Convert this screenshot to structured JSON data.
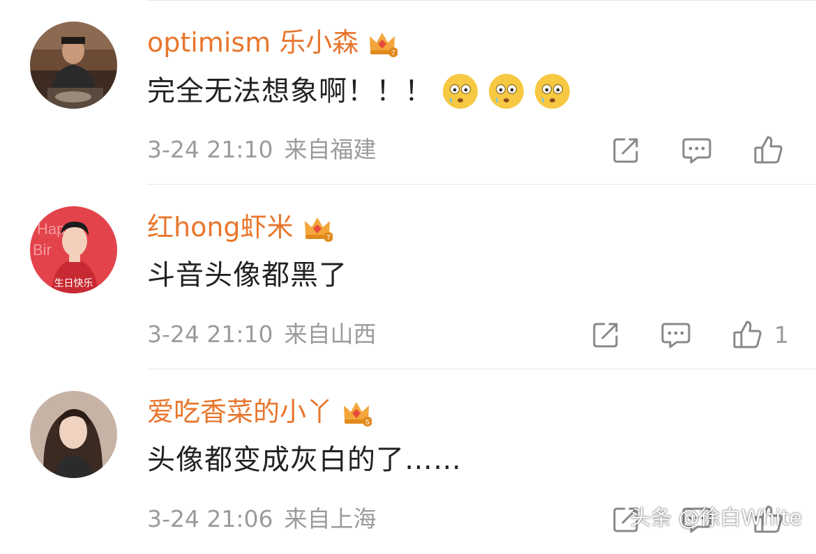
{
  "comments": [
    {
      "username": "optimism 乐小森",
      "crown_level": "7",
      "text": "完全无法想象啊！！！",
      "emoji_count": 3,
      "time": "3-24 21:10",
      "location": "来自福建",
      "like_count": ""
    },
    {
      "username": "红hong虾米",
      "crown_level": "7",
      "text": "斗音头像都黑了",
      "emoji_count": 0,
      "avatar_caption": "生日快乐",
      "time": "3-24 21:10",
      "location": "来自山西",
      "like_count": "1"
    },
    {
      "username": "爱吃香菜的小丫",
      "crown_level": "5",
      "text": "头像都变成灰白的了……",
      "emoji_count": 0,
      "time": "3-24 21:06",
      "location": "来自上海",
      "like_count": ""
    }
  ],
  "watermark": "头条 @徐白White",
  "colors": {
    "username": "#e8762d",
    "meta": "#9b9b9b",
    "body_text": "#222222",
    "divider": "#e6e6e6"
  },
  "icons": {
    "share": "share-icon",
    "reply": "comment-icon",
    "like": "thumbs-up-icon",
    "crown": "crown-badge-icon",
    "emoji": "flushed-face-emoji"
  }
}
